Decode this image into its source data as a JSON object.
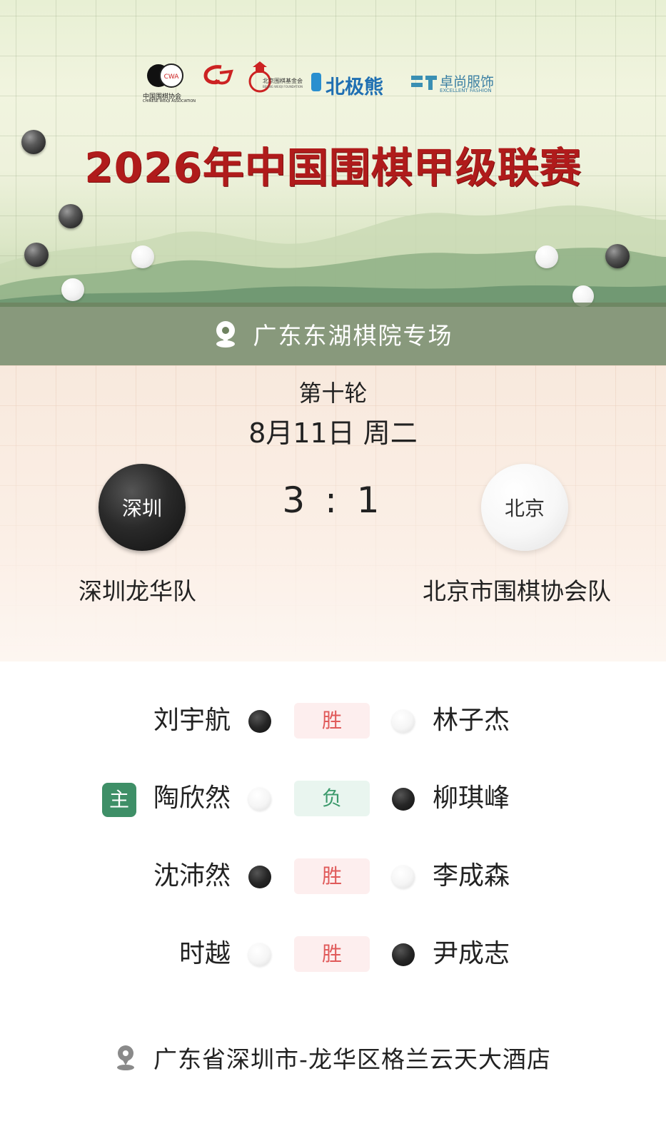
{
  "banner": {
    "logos": [
      {
        "name": "中国围棋协会",
        "sub": "CHINESE WEIQI ASSOCIATION"
      },
      {
        "name": "CG"
      },
      {
        "name": "北京围棋基金会",
        "sub": "BEIJING WEIQI FOUNDATION"
      },
      {
        "name": "北极熊"
      },
      {
        "name": "卓尚服饰",
        "sub": "EXCELLENT FASHION"
      }
    ],
    "title": "2026年中国围棋甲级联赛"
  },
  "venue": "广东东湖棋院专场",
  "match": {
    "round": "第十轮",
    "date": "8月11日 周二",
    "score": "3 : 1",
    "home": {
      "short": "深圳",
      "name": "深圳龙华队",
      "color": "black"
    },
    "away": {
      "short": "北京",
      "name": "北京市围棋协会队",
      "color": "white"
    }
  },
  "games": [
    {
      "left": "刘宇航",
      "left_stone": "black",
      "result": "胜",
      "right": "林子杰",
      "right_stone": "white",
      "captain": ""
    },
    {
      "left": "陶欣然",
      "left_stone": "white",
      "result": "负",
      "right": "柳琪峰",
      "right_stone": "black",
      "captain": "主"
    },
    {
      "left": "沈沛然",
      "left_stone": "black",
      "result": "胜",
      "right": "李成森",
      "right_stone": "white",
      "captain": ""
    },
    {
      "left": "时越",
      "left_stone": "white",
      "result": "胜",
      "right": "尹成志",
      "right_stone": "black",
      "captain": ""
    }
  ],
  "address": "广东省深圳市-龙华区格兰云天大酒店",
  "colors": {
    "title_red": "#b01b1b",
    "win_text": "#e05a5a",
    "lose_text": "#3c9a6c",
    "captain_badge": "#3e8f67",
    "venue_bar": "#6e825f"
  },
  "icons": {
    "venue": "location-pin-icon",
    "address": "location-pin-icon"
  }
}
